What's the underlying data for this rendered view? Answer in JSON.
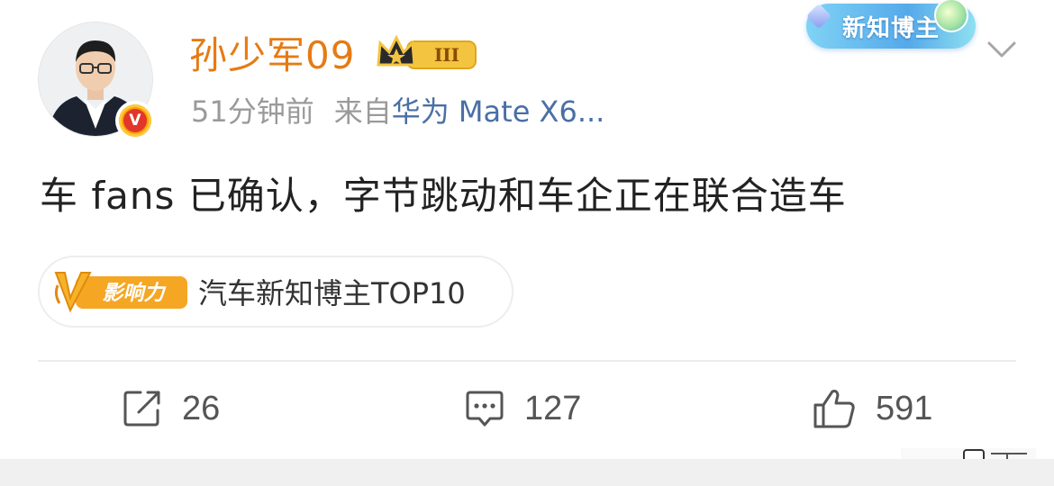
{
  "user": {
    "name": "孙少军09",
    "level_badge": "III"
  },
  "meta": {
    "time": "51分钟前",
    "source_prefix": "来自",
    "device": "华为 Mate X6..."
  },
  "promo_tag": {
    "label": "新知博主"
  },
  "verified_badge": {
    "letter": "V"
  },
  "post": {
    "text": "车 fans 已确认，字节跳动和车企正在联合造车"
  },
  "influence": {
    "badge_label": "影响力",
    "text": "汽车新知博主TOP10"
  },
  "actions": {
    "repost_count": "26",
    "comment_count": "127",
    "like_count": "591"
  },
  "colors": {
    "username": "#e57b14",
    "device": "#4a6fa5",
    "meta": "#9a9a9a",
    "badge_orange": "#f7a300"
  },
  "icons": {
    "repost": "share-edit-icon",
    "comment": "comment-icon",
    "like": "thumbs-up-icon",
    "chevron": "chevron-down-icon",
    "crown": "crown-icon"
  }
}
